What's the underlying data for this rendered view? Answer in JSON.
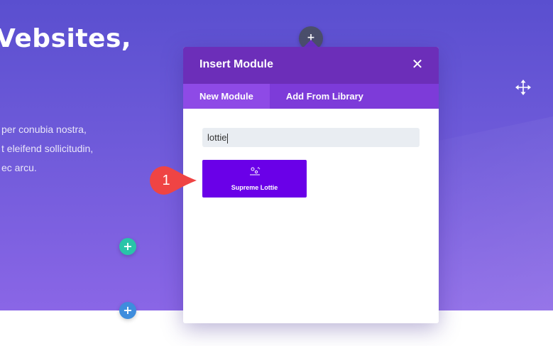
{
  "hero": {
    "heading": "Vebsites,",
    "lines": [
      "per conubia nostra,",
      "t eleifend sollicitudin,",
      "ec arcu."
    ]
  },
  "buttons": {
    "add_top": "+",
    "add_green": "+",
    "add_blue": "+"
  },
  "modal": {
    "title": "Insert Module",
    "close": "✕",
    "tabs": [
      {
        "label": "New Module",
        "active": true
      },
      {
        "label": "Add From Library",
        "active": false
      }
    ],
    "search": {
      "value": "lottie",
      "placeholder": ""
    },
    "results": [
      {
        "label": "Supreme Lottie",
        "icon": "lottie-icon"
      }
    ]
  },
  "annotation": {
    "number": "1",
    "color": "#ef4444"
  },
  "colors": {
    "header": "#6c2eb9",
    "tab_bar": "#7d3bd9",
    "active_tab": "#8e4ae6",
    "module_card": "#6a00e8",
    "add_green": "#29c4a9",
    "add_blue": "#3e8ddd"
  }
}
